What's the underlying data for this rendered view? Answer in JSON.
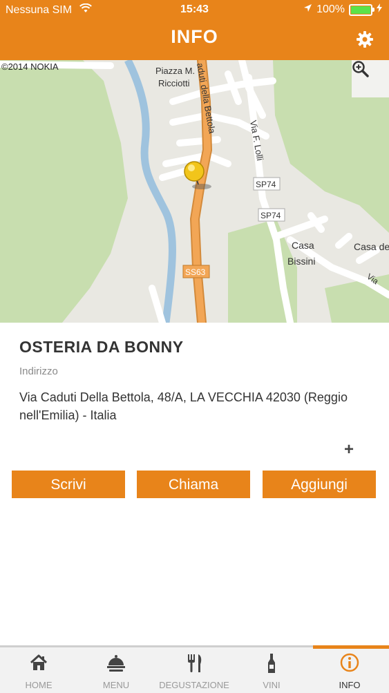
{
  "status": {
    "carrier": "Nessuna SIM",
    "time": "15:43",
    "battery": "100%"
  },
  "header": {
    "title": "INFO",
    "settings_icon": "gear-icon"
  },
  "map": {
    "copyright": "©2014 NOKIA",
    "labels": {
      "piazza": "Piazza M.",
      "ricciotti": "Ricciotti",
      "caduti": "aduti della Bettola",
      "lolli": "Via F. Lolli",
      "sp74a": "SP74",
      "sp74b": "SP74",
      "casa1": "Casa",
      "bissini": "Bissini",
      "casa2": "Casa de",
      "via": "Via",
      "ss63": "SS63"
    },
    "zoom_icon": "magnifier-plus-icon"
  },
  "place": {
    "name": "OSTERIA DA BONNY",
    "address_label": "Indirizzo",
    "address": "Via Caduti Della Bettola, 48/A, LA VECCHIA 42030 (Reggio nell'Emilia) - Italia",
    "more": "+"
  },
  "actions": {
    "write": "Scrivi",
    "call": "Chiama",
    "add": "Aggiungi"
  },
  "tabs": [
    {
      "label": "HOME",
      "icon": "home-icon"
    },
    {
      "label": "MENU",
      "icon": "cloche-icon"
    },
    {
      "label": "DEGUSTAZIONE",
      "icon": "fork-knife-icon"
    },
    {
      "label": "VINI",
      "icon": "wine-bottle-icon"
    },
    {
      "label": "INFO",
      "icon": "info-icon"
    }
  ],
  "colors": {
    "accent": "#e8841a",
    "battery": "#5be24a",
    "tab_inactive": "#999999"
  }
}
